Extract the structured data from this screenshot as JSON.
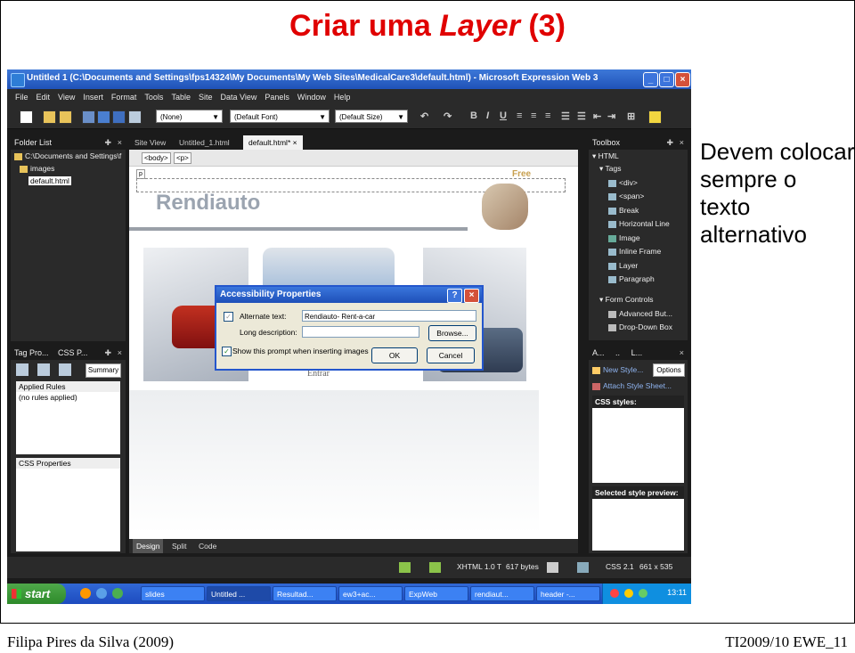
{
  "slide": {
    "title_part1": "Criar uma ",
    "title_italic": "Layer",
    "title_part2": " (3)",
    "note_lines": [
      "Devem colocar",
      "sempre o",
      "texto",
      "alternativo"
    ],
    "footer_left": "Filipa Pires da Silva (2009)",
    "footer_right": "TI2009/10 EWE_11"
  },
  "window": {
    "title": "Untitled 1 (C:\\Documents and Settings\\fps14324\\My Documents\\My Web Sites\\MedicalCare3\\default.html) - Microsoft Expression Web 3",
    "menu": [
      "File",
      "Edit",
      "View",
      "Insert",
      "Format",
      "Tools",
      "Table",
      "Site",
      "Data View",
      "Panels",
      "Window",
      "Help"
    ],
    "toolbar": {
      "style_select": "(None)",
      "font_select": "(Default Font)",
      "size_select": "(Default Size)",
      "bold": "B",
      "italic": "I",
      "underline": "U"
    }
  },
  "folder_list": {
    "title": "Folder List",
    "items": [
      "C:\\Documents and Settings\\f",
      "images",
      "default.html"
    ]
  },
  "tag_panel": {
    "tabs": [
      "Tag Pro...",
      "CSS P..."
    ],
    "summary_button": "Summary",
    "applied_rules_header": "Applied Rules",
    "no_rules": "(no rules applied)",
    "css_properties_header": "CSS Properties"
  },
  "editor": {
    "tabs": [
      "Site View",
      "Untitled_1.html",
      "default.html*"
    ],
    "tag_chips": [
      "<body>",
      "<p>"
    ],
    "p_marker": "p",
    "page_logo": "Rendiauto",
    "page_link": "Free",
    "enter_button": "Entrar",
    "view_tabs": [
      "Design",
      "Split",
      "Code"
    ]
  },
  "dialog": {
    "title": "Accessibility Properties",
    "alt_label": "Alternate text:",
    "alt_value": "Rendiauto- Rent-a-car",
    "long_desc_label": "Long description:",
    "long_desc_value": "",
    "browse": "Browse...",
    "show_prompt": "Show this prompt when inserting images",
    "ok": "OK",
    "cancel": "Cancel"
  },
  "toolbox": {
    "title": "Toolbox",
    "html_group": "HTML",
    "tags_group": "Tags",
    "tags": [
      "<div>",
      "<span>",
      "Break",
      "Horizontal Line",
      "Image",
      "Inline Frame",
      "Layer",
      "Paragraph"
    ],
    "form_group": "Form Controls",
    "form_items": [
      "Advanced But...",
      "Drop-Down Box"
    ]
  },
  "styles_panel": {
    "tabs": [
      "A...",
      "..",
      "L..."
    ],
    "new_style": "New Style...",
    "options": "Options",
    "attach_sheet": "Attach Style Sheet...",
    "css_styles": "CSS styles:",
    "preview": "Selected style preview:"
  },
  "status": {
    "doctype": "XHTML 1.0 T",
    "size": "617 bytes",
    "css": "CSS 2.1",
    "dimensions": "661 x 535"
  },
  "taskbar": {
    "start": "start",
    "items": [
      "slides",
      "Untitled ...",
      "Resultad...",
      "ew3+ac...",
      "ExpWeb",
      "rendiaut...",
      "header -..."
    ],
    "clock": "13:11"
  },
  "colors": {
    "title_red": "#e00000",
    "xp_blue": "#2456cc",
    "dark_ui": "#1b1b1b"
  }
}
